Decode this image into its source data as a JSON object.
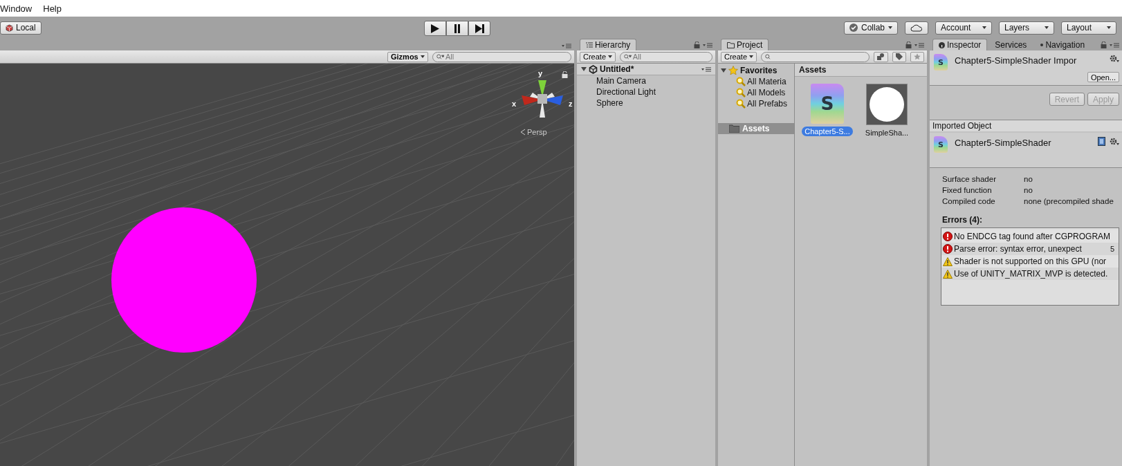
{
  "menu": [
    {
      "label": "Window"
    },
    {
      "label": "Help"
    }
  ],
  "toolbar": {
    "pivot": "Local",
    "collab": "Collab",
    "account": "Account",
    "layers": "Layers",
    "layout": "Layout"
  },
  "scene": {
    "gizmos": "Gizmos",
    "search_placeholder": "All",
    "axes": [
      {
        "label": "y"
      },
      {
        "label": "x"
      },
      {
        "label": "z"
      }
    ],
    "projection": "Persp"
  },
  "hierarchy": {
    "tab": "Hierarchy",
    "create": "Create",
    "search_placeholder": "All",
    "scene": "Untitled*",
    "expanded": true,
    "items": [
      {
        "label": "Main Camera"
      },
      {
        "label": "Directional Light"
      },
      {
        "label": "Sphere"
      }
    ]
  },
  "project": {
    "tab": "Project",
    "create": "Create",
    "favorites": {
      "label": "Favorites",
      "expanded": true,
      "items": [
        {
          "label": "All Materia"
        },
        {
          "label": "All Models"
        },
        {
          "label": "All Prefabs"
        }
      ]
    },
    "folders": [
      {
        "label": "Assets",
        "selected": true
      }
    ],
    "breadcrumb": "Assets",
    "assets": [
      {
        "kind": "shader",
        "glyph": "S",
        "name": "Chapter5-S...",
        "selected": true
      },
      {
        "kind": "material",
        "name": "SimpleSha...",
        "selected": false
      }
    ]
  },
  "inspector": {
    "tabs": [
      {
        "label": "Inspector",
        "selected": true
      },
      {
        "label": "Services",
        "selected": false
      },
      {
        "label": "Navigation",
        "selected": false
      }
    ],
    "icon_glyph": "S",
    "title": "Chapter5-SimpleShader Impor",
    "open": "Open...",
    "buttons": [
      {
        "label": "Revert",
        "disabled": true
      },
      {
        "label": "Apply",
        "disabled": true
      }
    ],
    "section": "Imported Object",
    "object_glyph": "S",
    "object_name": "Chapter5-SimpleShader",
    "properties": [
      {
        "label": "Surface shader",
        "value": "no"
      },
      {
        "label": "Fixed function",
        "value": "no"
      },
      {
        "label": "Compiled code",
        "value": "none (precompiled shade"
      }
    ],
    "errors_title": "Errors (4):",
    "errors": [
      {
        "kind": "error",
        "text": "No ENDCG tag found after CGPROGRAM"
      },
      {
        "kind": "error",
        "text": "Parse error: syntax error, unexpect",
        "line": "5"
      },
      {
        "kind": "warning",
        "text": "Shader is not supported on this GPU (nor"
      },
      {
        "kind": "warning",
        "text": "Use of UNITY_MATRIX_MVP is detected."
      }
    ]
  }
}
